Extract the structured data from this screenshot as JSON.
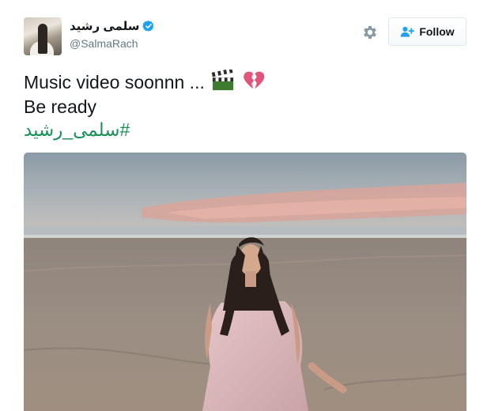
{
  "user": {
    "display_name": "سلمى رشيد",
    "handle": "@SalmaRach",
    "verified": true
  },
  "actions": {
    "follow_label": "Follow",
    "settings_icon": "gear-icon",
    "follow_icon": "add-user-icon"
  },
  "tweet": {
    "line1": "Music video soonnn ...",
    "line1_emojis": [
      "clapper-board-emoji",
      "broken-heart-emoji"
    ],
    "line2": "Be ready",
    "hashtag": "#سلمى_رشيد"
  },
  "colors": {
    "verified": "#1da1f2",
    "hashtag": "#1b8f5a",
    "handle": "#657786"
  }
}
